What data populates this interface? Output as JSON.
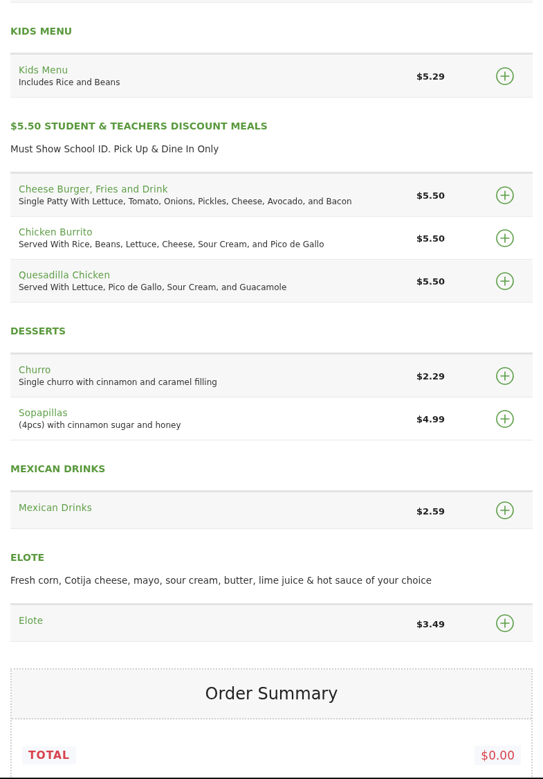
{
  "sections": [
    {
      "title": "KIDS MENU",
      "items": [
        {
          "name": "Kids Menu",
          "description": "Includes Rice and Beans",
          "price": "$5.29"
        }
      ]
    },
    {
      "title": "$5.50 STUDENT & TEACHERS DISCOUNT MEALS",
      "note": "Must Show School ID. Pick Up & Dine In Only",
      "items": [
        {
          "name": "Cheese Burger, Fries and Drink",
          "description": "Single Patty With Lettuce, Tomato, Onions, Pickles, Cheese, Avocado, and Bacon",
          "price": "$5.50"
        },
        {
          "name": "Chicken Burrito",
          "description": "Served With Rice, Beans, Lettuce, Cheese, Sour Cream, and Pico de Gallo",
          "price": "$5.50"
        },
        {
          "name": "Quesadilla Chicken",
          "description": "Served With Lettuce, Pico de Gallo, Sour Cream, and Guacamole",
          "price": "$5.50"
        }
      ]
    },
    {
      "title": "DESSERTS",
      "items": [
        {
          "name": "Churro",
          "description": "Single churro with cinnamon and caramel filling",
          "price": "$2.29"
        },
        {
          "name": "Sopapillas",
          "description": "(4pcs) with cinnamon sugar and honey",
          "price": "$4.99"
        }
      ]
    },
    {
      "title": "MEXICAN DRINKS",
      "items": [
        {
          "name": "Mexican Drinks",
          "price": "$2.59"
        }
      ]
    },
    {
      "title": "ELOTE",
      "note": "Fresh corn, Cotija cheese, mayo, sour cream, butter, lime juice & hot sauce of your choice",
      "items": [
        {
          "name": "Elote",
          "price": "$3.49"
        }
      ]
    }
  ],
  "order_summary": {
    "title": "Order Summary",
    "total_label": "TOTAL",
    "total_value": "$0.00"
  }
}
